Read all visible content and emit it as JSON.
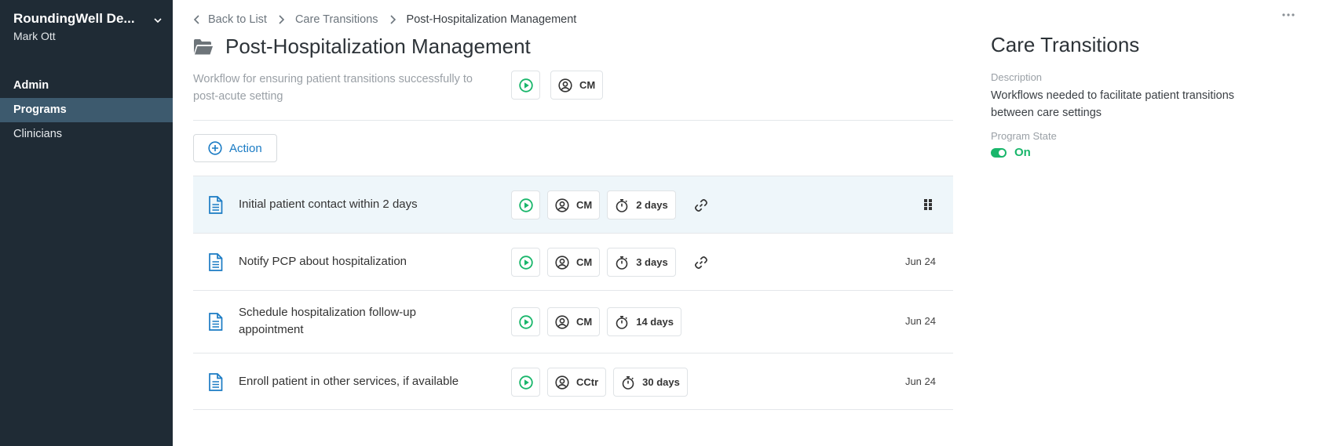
{
  "sidebar": {
    "org_name": "RoundingWell De...",
    "user_name": "Mark Ott",
    "items": [
      {
        "label": "Admin"
      },
      {
        "label": "Programs"
      },
      {
        "label": "Clinicians"
      }
    ]
  },
  "breadcrumb": {
    "back": "Back to List",
    "parent": "Care Transitions",
    "current": "Post-Hospitalization Management"
  },
  "workflow": {
    "icon": "folder-open-icon",
    "title": "Post-Hospitalization Management",
    "description": "Workflow for ensuring patient transitions successfully to post-acute setting",
    "owner": "CM"
  },
  "action_button": {
    "label": "Action"
  },
  "actions": [
    {
      "name": "Initial patient contact within 2 days",
      "owner": "CM",
      "duration": "2 days",
      "has_link": true,
      "date": "",
      "selected": true
    },
    {
      "name": "Notify PCP about hospitalization",
      "owner": "CM",
      "duration": "3 days",
      "has_link": true,
      "date": "Jun 24",
      "selected": false
    },
    {
      "name": "Schedule hospitalization follow-up appointment",
      "owner": "CM",
      "duration": "14 days",
      "has_link": false,
      "date": "Jun 24",
      "selected": false
    },
    {
      "name": "Enroll patient in other services, if available",
      "owner": "CCtr",
      "duration": "30 days",
      "has_link": false,
      "date": "Jun 24",
      "selected": false
    }
  ],
  "panel": {
    "title": "Care Transitions",
    "description_label": "Description",
    "description": "Workflows needed to facilitate patient transitions between care settings",
    "state_label": "Program State",
    "state": "On"
  },
  "colors": {
    "sidebar_bg": "#1f2b35",
    "sidebar_active": "#3d5a6e",
    "accent_blue": "#1a7bc4",
    "status_green": "#19b66b",
    "selected_row": "#eef6fa"
  }
}
